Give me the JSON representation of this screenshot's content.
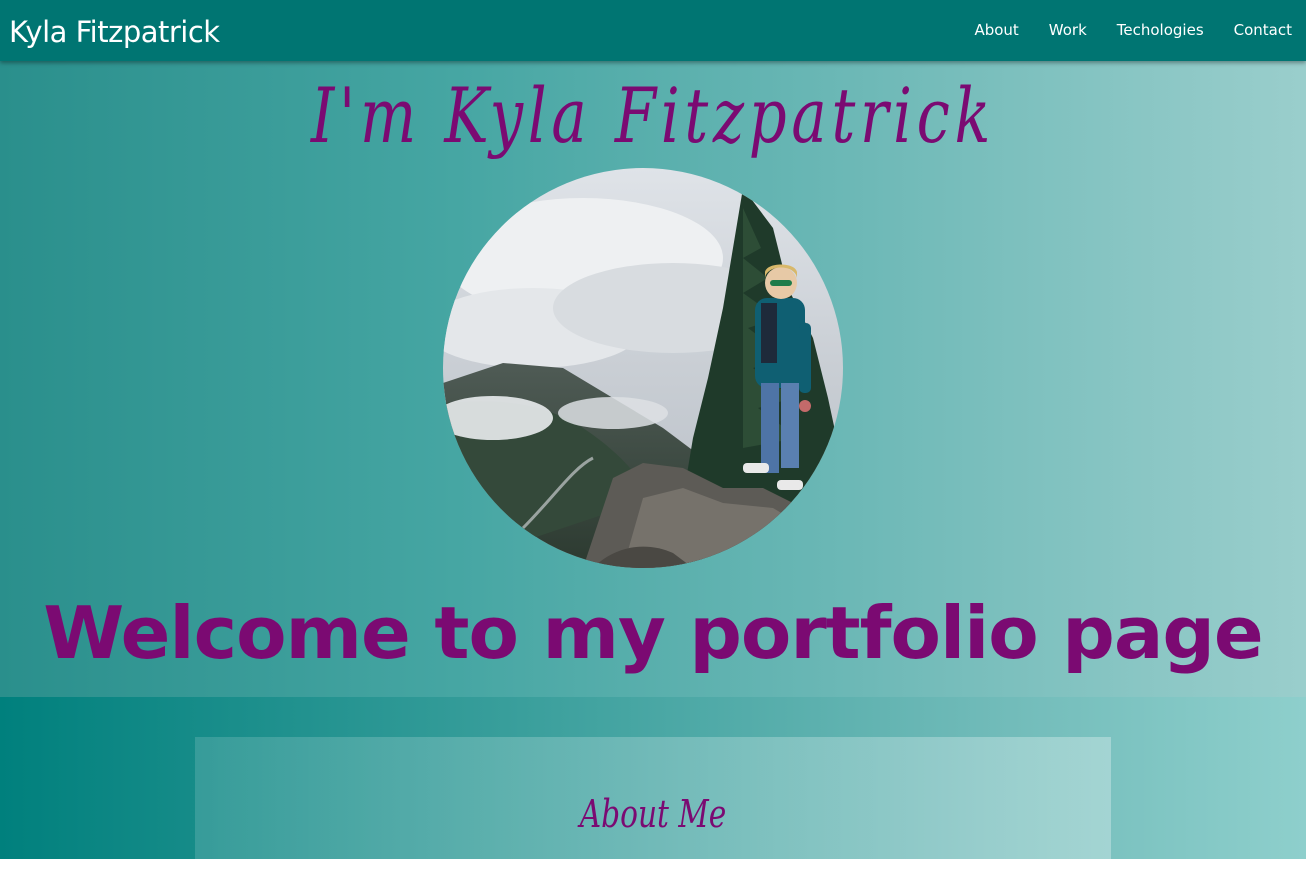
{
  "navbar": {
    "brand": "Kyla Fitzpatrick",
    "links": [
      {
        "label": "About"
      },
      {
        "label": "Work"
      },
      {
        "label": "Techologies"
      },
      {
        "label": "Contact"
      }
    ]
  },
  "hero": {
    "heading": "I'm Kyla Fitzpatrick",
    "welcome": "Welcome to my portfolio page"
  },
  "about": {
    "title": "About Me"
  },
  "colors": {
    "navbar": "#007572",
    "accent": "#7b0a72",
    "hero_gradient_start": "#2a8f8c",
    "hero_gradient_end": "#9acecc"
  },
  "icons": [
    "profile-photo"
  ]
}
